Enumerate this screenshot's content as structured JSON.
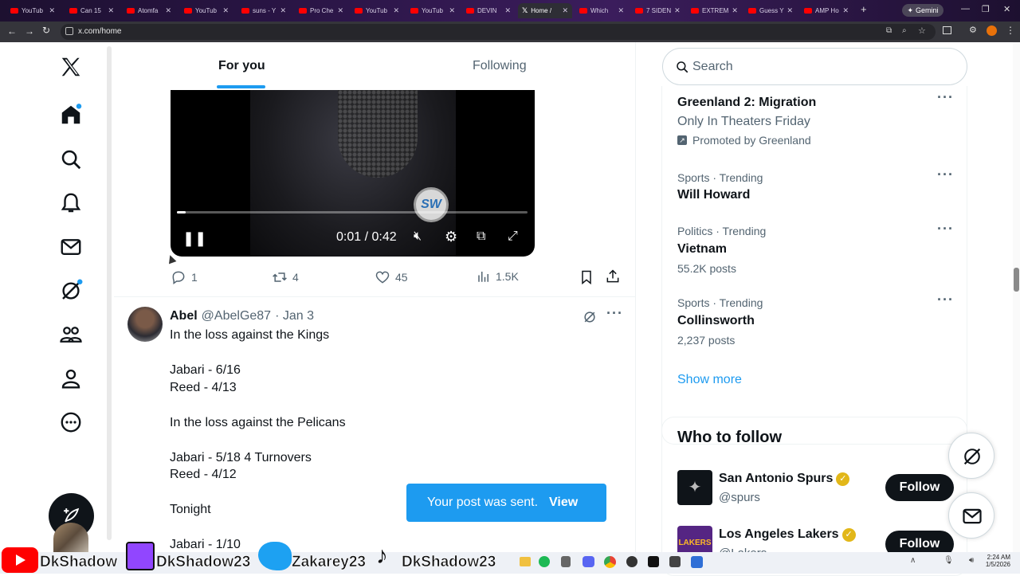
{
  "browser": {
    "tabs": [
      "YouTub",
      "Can 15",
      "Atomfa",
      "YouTub",
      "suns - Y",
      "Pro Che",
      "YouTub",
      "YouTub",
      "DEVIN",
      "Home /",
      "Which",
      "7 SIDEN",
      "EXTREM",
      "Guess Y",
      "AMP Ho"
    ],
    "active_tab": "Home /",
    "gemini_label": "Gemini",
    "url": "x.com/home"
  },
  "timeline": {
    "tab_for_you": "For you",
    "tab_following": "Following",
    "video": {
      "time": "0:01 / 0:42",
      "logo_text": "SW",
      "progress": 0.024
    },
    "actions": {
      "replies": "1",
      "reposts": "4",
      "likes": "45",
      "views": "1.5K"
    },
    "tweet": {
      "name": "Abel",
      "handle": "@AbelGe87",
      "date": "· Jan 3",
      "lines": [
        "In the loss against the Kings",
        "Jabari - 6/16",
        "Reed - 4/13",
        "In the loss against the Pelicans",
        "Jabari - 5/18 4 Turnovers",
        "Reed - 4/12",
        "Tonight",
        "Jabari - 1/10"
      ]
    }
  },
  "toast": {
    "message": "Your post was sent.",
    "action": "View"
  },
  "sidebar": {
    "search_placeholder": "Search",
    "trends": [
      {
        "title": "Greenland 2: Migration",
        "sub": "Only In Theaters Friday",
        "promo": "Promoted by Greenland"
      },
      {
        "category": "Sports · Trending",
        "title": "Will Howard"
      },
      {
        "category": "Politics · Trending",
        "title": "Vietnam",
        "posts": "55.2K posts"
      },
      {
        "category": "Sports · Trending",
        "title": "Collinsworth",
        "posts": "2,237 posts"
      }
    ],
    "show_more": "Show more",
    "who_to_follow": {
      "heading": "Who to follow",
      "accounts": [
        {
          "name": "San Antonio Spurs",
          "handle": "@spurs",
          "button": "Follow"
        },
        {
          "name": "Los Angeles Lakers",
          "handle": "@Lakers",
          "button": "Follow"
        }
      ]
    }
  },
  "taskbar": {
    "overlay_names": [
      "DkShadow",
      "DkShadow23",
      "Zakarey23",
      "DkShadow23"
    ],
    "time": "2:24 AM",
    "date": "1/5/2026"
  },
  "colors": {
    "accent": "#1d9bf0",
    "text": "#0f1419",
    "muted": "#536471",
    "verified": "#e2b719"
  }
}
